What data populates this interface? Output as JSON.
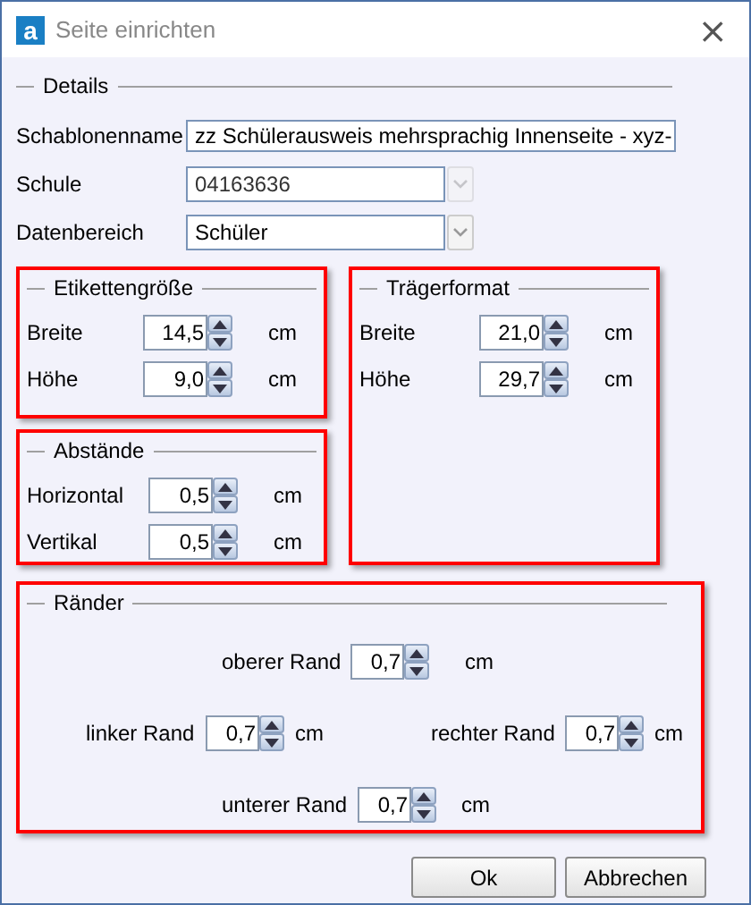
{
  "window": {
    "title": "Seite einrichten",
    "logo": "a",
    "close": "×"
  },
  "details": {
    "legend": "Details",
    "highlighted": false,
    "fields": [
      {
        "kind": "text",
        "label": "Schablonenname",
        "value": "zz Schülerausweis mehrsprachig Innenseite - xyz-"
      },
      {
        "kind": "combo",
        "label": "Schule",
        "value": "04163636",
        "disabled": true
      },
      {
        "kind": "combo",
        "label": "Datenbereich",
        "value": "Schüler",
        "disabled": false
      }
    ]
  },
  "etikettengroesse": {
    "legend": "Etikettengröße",
    "highlighted": true,
    "rows": [
      {
        "label": "Breite",
        "value": "14,5",
        "unit": "cm"
      },
      {
        "label": "Höhe",
        "value": "9,0",
        "unit": "cm"
      }
    ]
  },
  "abstaende": {
    "legend": "Abstände",
    "highlighted": true,
    "rows": [
      {
        "label": "Horizontal",
        "value": "0,5",
        "unit": "cm"
      },
      {
        "label": "Vertikal",
        "value": "0,5",
        "unit": "cm"
      }
    ]
  },
  "traegerformat": {
    "legend": "Trägerformat",
    "highlighted": true,
    "rows": [
      {
        "label": "Breite",
        "value": "21,0",
        "unit": "cm"
      },
      {
        "label": "Höhe",
        "value": "29,7",
        "unit": "cm"
      }
    ]
  },
  "raender": {
    "legend": "Ränder",
    "highlighted": true,
    "top": {
      "label": "oberer Rand",
      "value": "0,7",
      "unit": "cm"
    },
    "left": {
      "label": "linker Rand",
      "value": "0,7",
      "unit": "cm"
    },
    "right": {
      "label": "rechter Rand",
      "value": "0,7",
      "unit": "cm"
    },
    "bottom": {
      "label": "unterer Rand",
      "value": "0,7",
      "unit": "cm"
    }
  },
  "buttons": [
    {
      "label": "Ok"
    },
    {
      "label": "Abbrechen"
    }
  ]
}
